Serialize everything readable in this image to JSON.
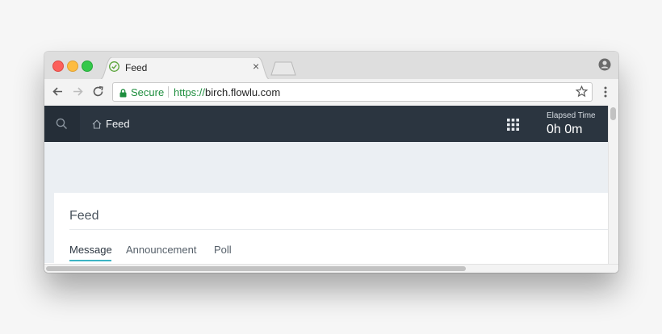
{
  "browser": {
    "tab_title": "Feed",
    "tab_close": "×",
    "secure_label": "Secure",
    "url_scheme": "https://",
    "url_rest": "birch.flowlu.com"
  },
  "icons": {
    "favicon": "shield-check-icon",
    "back": "arrow-left-icon",
    "forward": "arrow-right-icon",
    "reload": "reload-icon",
    "lock": "lock-icon",
    "bookmark": "star-icon",
    "menu": "kebab-menu-icon",
    "profile": "profile-icon",
    "search": "search-icon",
    "home": "home-icon",
    "apps": "grid-icon"
  },
  "app": {
    "nav_title": "Feed",
    "elapsed_label": "Elapsed Time",
    "elapsed_value": "0h 0m"
  },
  "card": {
    "title": "Feed",
    "tabs": [
      {
        "label": "Message",
        "active": true
      },
      {
        "label": "Announcement",
        "active": false
      },
      {
        "label": "Poll",
        "active": false
      }
    ]
  },
  "colors": {
    "appbar": "#2b3540",
    "accent": "#3cb4c4",
    "secure": "#1e8e3e",
    "content_bg": "#ebeff3"
  }
}
